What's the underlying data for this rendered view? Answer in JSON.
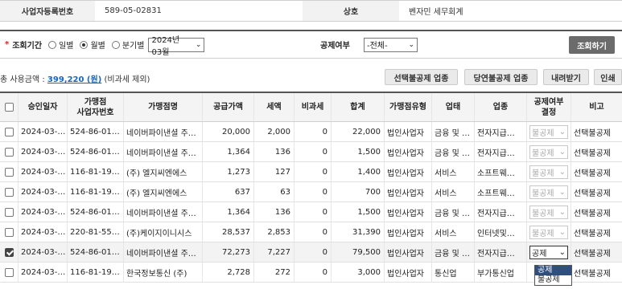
{
  "info": {
    "biz_no_label": "사업자등록번호",
    "biz_no_value": "589-05-02831",
    "name_label": "상호",
    "name_value": "벤자민 세무회계"
  },
  "search": {
    "required_mark": "*",
    "period_label": "조회기간",
    "opt_daily": "일별",
    "opt_monthly": "월별",
    "opt_quarterly": "분기별",
    "month_value": "2024년 03월",
    "deduct_label": "공제여부",
    "deduct_value": "-전체-",
    "search_button": "조회하기"
  },
  "summary": {
    "prefix": "총 사용금액 : ",
    "amount": "399,220 (원)",
    "suffix": "(비과세 제외)"
  },
  "buttons": {
    "optional_deduct": "선택불공제 업종",
    "natural_deduct": "당연불공제 업종",
    "download": "내려받기",
    "print": "인쇄"
  },
  "columns": {
    "date": "승인일자",
    "merchant_biz_no_1": "가맹점",
    "merchant_biz_no_2": "사업자번호",
    "merchant_name": "가맹점명",
    "supply": "공급가액",
    "tax": "세액",
    "nontax": "비과세",
    "total": "합계",
    "merchant_type": "가맹점유형",
    "biz_type": "업태",
    "industry": "업종",
    "deduct_1": "공제여부",
    "deduct_2": "결정",
    "note": "비고"
  },
  "rows": [
    {
      "date": "2024-03-…",
      "bizno": "524-86-01…",
      "name": "네이버파이낸셜 주…",
      "supply": "20,000",
      "tax": "2,000",
      "nontax": "0",
      "total": "22,000",
      "mtype": "법인사업자",
      "btype": "금융 및 …",
      "industry": "전자지급…",
      "deduct": "불공제",
      "note": "선택불공제"
    },
    {
      "date": "2024-03-…",
      "bizno": "524-86-01…",
      "name": "네이버파이낸셜 주…",
      "supply": "1,364",
      "tax": "136",
      "nontax": "0",
      "total": "1,500",
      "mtype": "법인사업자",
      "btype": "금융 및 …",
      "industry": "전자지급…",
      "deduct": "불공제",
      "note": "선택불공제"
    },
    {
      "date": "2024-03-…",
      "bizno": "116-81-19…",
      "name": "(주) 엘지씨엔에스",
      "supply": "1,273",
      "tax": "127",
      "nontax": "0",
      "total": "1,400",
      "mtype": "법인사업자",
      "btype": "서비스",
      "industry": "소프트웨…",
      "deduct": "불공제",
      "note": "선택불공제"
    },
    {
      "date": "2024-03-…",
      "bizno": "116-81-19…",
      "name": "(주) 엘지씨엔에스",
      "supply": "637",
      "tax": "63",
      "nontax": "0",
      "total": "700",
      "mtype": "법인사업자",
      "btype": "서비스",
      "industry": "소프트웨…",
      "deduct": "불공제",
      "note": "선택불공제"
    },
    {
      "date": "2024-03-…",
      "bizno": "524-86-01…",
      "name": "네이버파이낸셜 주…",
      "supply": "1,364",
      "tax": "136",
      "nontax": "0",
      "total": "1,500",
      "mtype": "법인사업자",
      "btype": "금융 및 …",
      "industry": "전자지급…",
      "deduct": "불공제",
      "note": "선택불공제"
    },
    {
      "date": "2024-03-…",
      "bizno": "220-81-55…",
      "name": "(주)케이지이니시스",
      "supply": "28,537",
      "tax": "2,853",
      "nontax": "0",
      "total": "31,390",
      "mtype": "법인사업자",
      "btype": "서비스",
      "industry": "인터넷및…",
      "deduct": "불공제",
      "note": "선택불공제"
    },
    {
      "date": "2024-03-…",
      "bizno": "524-86-01…",
      "name": "네이버파이낸셜 주…",
      "supply": "72,273",
      "tax": "7,227",
      "nontax": "0",
      "total": "79,500",
      "mtype": "법인사업자",
      "btype": "금융 및 …",
      "industry": "전자지급…",
      "deduct": "공제",
      "note": "선택불공제",
      "checked": true
    },
    {
      "date": "2024-03-…",
      "bizno": "116-81-19…",
      "name": "한국정보통신 (주)",
      "supply": "2,728",
      "tax": "272",
      "nontax": "0",
      "total": "3,000",
      "mtype": "법인사업자",
      "btype": "통신업",
      "industry": "부가통신업",
      "deduct": "",
      "note": "선택불공제"
    }
  ],
  "dropdown_options": [
    "공제",
    "불공제"
  ],
  "colors": {
    "link": "#1a66b8",
    "required": "#dd2222",
    "search_button_bg": "#6b6b6b",
    "dropdown_highlight": "#2f4f7f"
  }
}
